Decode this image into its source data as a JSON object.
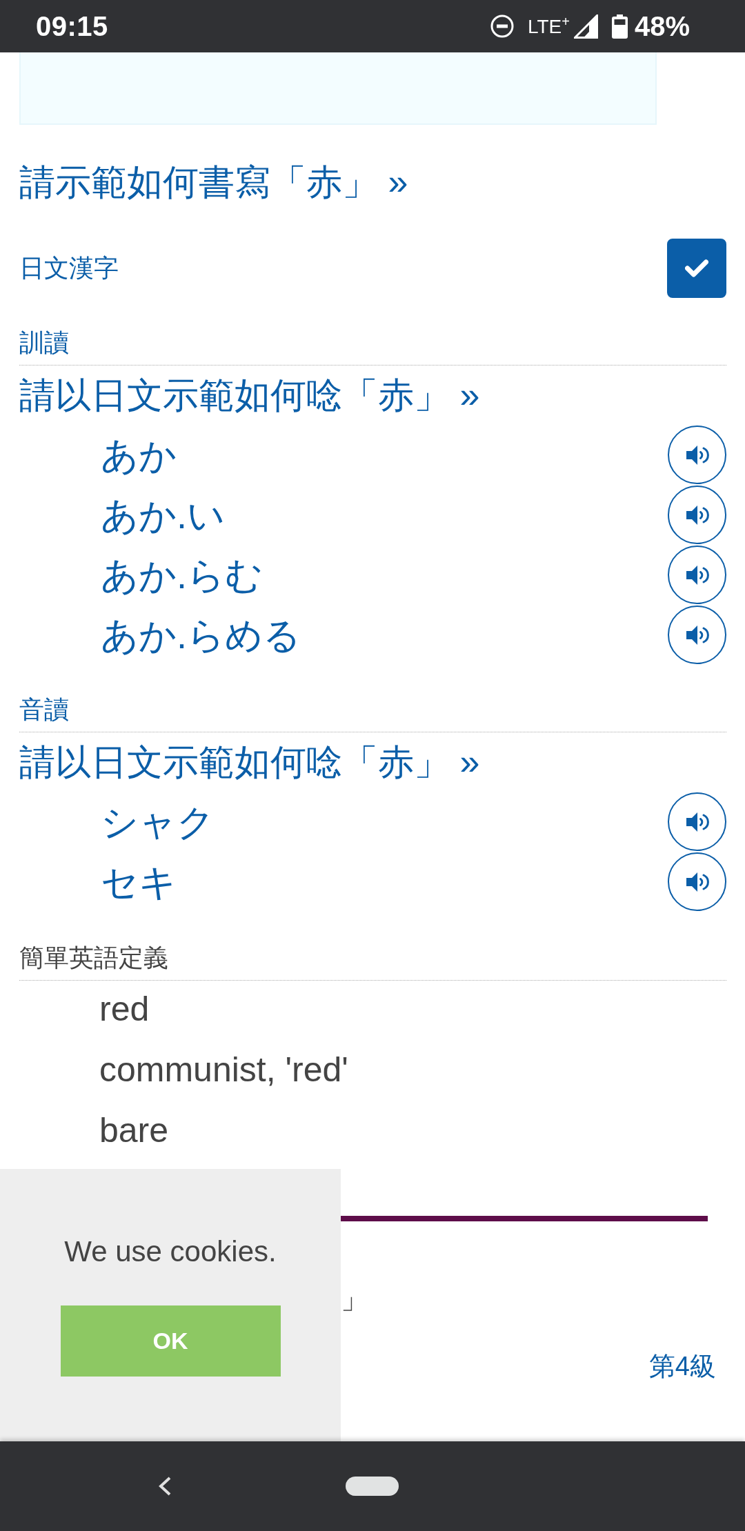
{
  "status_bar": {
    "time": "09:15",
    "network": "LTE$^{+}$",
    "battery": "48%"
  },
  "write_link": "請示範如何書寫「赤」 »",
  "kanji_toggle": {
    "label": "日文漢字",
    "checked": true
  },
  "sections": [
    {
      "kind": "readings",
      "heading": "訓讀",
      "link": "請以日文示範如何唸「赤」 »",
      "items": [
        "あか",
        "あか.い",
        "あか.らむ",
        "あか.らめる"
      ]
    },
    {
      "kind": "readings",
      "heading": "音讀",
      "link": "請以日文示範如何唸「赤」 »",
      "items": [
        "シャク",
        "セキ"
      ]
    },
    {
      "kind": "definitions",
      "heading": "簡單英語定義",
      "items": [
        "red",
        "communist, 'red'",
        "bare"
      ]
    }
  ],
  "covered_text": "」",
  "grade_link": "第4級",
  "cookie_notice": {
    "message": "We use cookies.",
    "button": "OK"
  }
}
